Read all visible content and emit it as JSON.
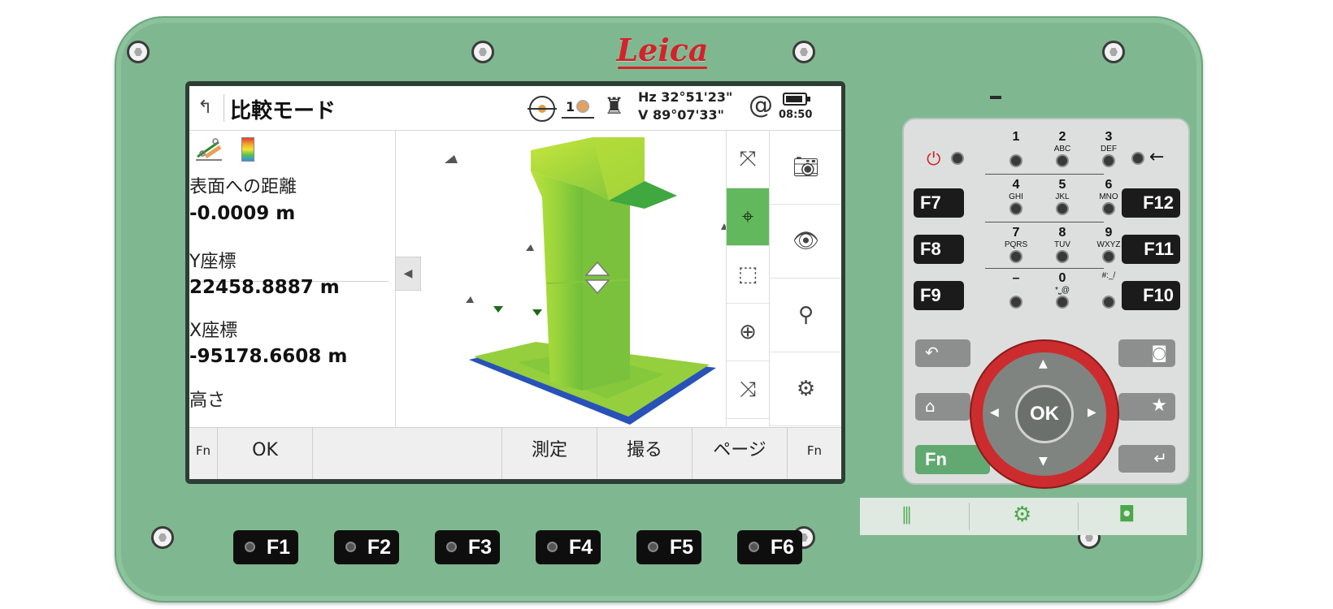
{
  "brand": "Leica",
  "title_bar": {
    "title": "比較モード",
    "prism_number": "1",
    "hz": "Hz 32°51'23\"",
    "v": "V   89°07'33\"",
    "clock": "08:50"
  },
  "left_panel": {
    "items": [
      {
        "label": "表面への距離",
        "value": "-0.0009 m"
      },
      {
        "label": "Y座標",
        "value": "22458.8887 m"
      },
      {
        "label": "X座標",
        "value": "-95178.6608 m"
      },
      {
        "label": "高さ",
        "value": ""
      }
    ]
  },
  "softkeys": {
    "fn_left": "Fn",
    "ok": "OK",
    "measure": "測定",
    "capture": "撮る",
    "page": "ページ",
    "fn_right": "Fn"
  },
  "fkeys_bottom": [
    "F1",
    "F2",
    "F3",
    "F4",
    "F5",
    "F6"
  ],
  "fkeys_left": [
    "F7",
    "F8",
    "F9"
  ],
  "fkeys_right": [
    "F12",
    "F11",
    "F10"
  ],
  "numpad": [
    {
      "num": "1",
      "sub": ""
    },
    {
      "num": "2",
      "sub": "ABC"
    },
    {
      "num": "3",
      "sub": "DEF"
    },
    {
      "num": "4",
      "sub": "GHI"
    },
    {
      "num": "5",
      "sub": "JKL"
    },
    {
      "num": "6",
      "sub": "MNO"
    },
    {
      "num": "7",
      "sub": "PQRS"
    },
    {
      "num": "8",
      "sub": "TUV"
    },
    {
      "num": "9",
      "sub": "WXYZ"
    },
    {
      "num": "–",
      "sub": ""
    },
    {
      "num": "0",
      "sub": "*⎵@"
    },
    {
      "num": "",
      "sub": "#:_/"
    }
  ],
  "ok_key": "OK",
  "fn_key": "Fn",
  "colors": {
    "device_body": "#7fb890",
    "active_tool": "#62b85c",
    "dpad_ring": "#cc2c2e",
    "brand_red": "#d2232a"
  }
}
